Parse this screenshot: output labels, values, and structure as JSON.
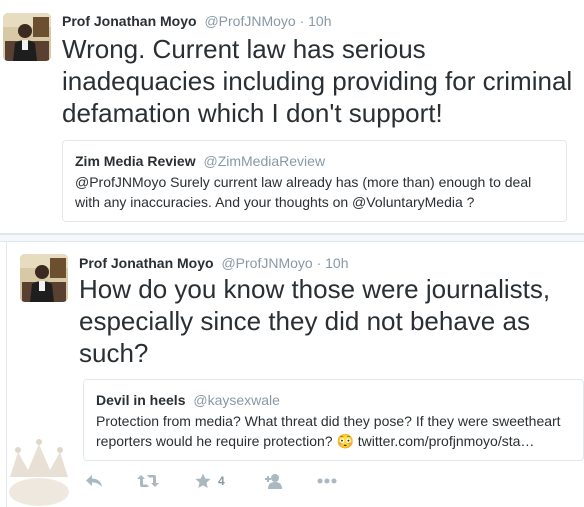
{
  "tweets": [
    {
      "author_name": "Prof Jonathan Moyo",
      "author_handle": "@ProfJNMoyo",
      "separator": "·",
      "time": "10h",
      "text": "Wrong. Current law has serious inadequacies including providing for criminal defamation which I don't support!",
      "quote": {
        "author_name": "Zim Media Review",
        "author_handle": "@ZimMediaReview",
        "text": "@ProfJNMoyo Surely current law already has (more than) enough to deal with any inaccuracies. And your thoughts on @VoluntaryMedia ?"
      }
    },
    {
      "author_name": "Prof Jonathan Moyo",
      "author_handle": "@ProfJNMoyo",
      "separator": "·",
      "time": "10h",
      "text": "How do you know those were journalists, especially since they did not behave as such?",
      "quote": {
        "author_name": "Devil in heels",
        "author_handle": "@kaysexwale",
        "text": "Protection from media? What threat did they pose? If they were sweetheart reporters would he require protection? 😳 twitter.com/profjnmoyo/sta…"
      },
      "actions": {
        "reply_icon": "reply-icon",
        "retweet_icon": "retweet-icon",
        "favorite_icon": "star-icon",
        "favorite_count": "4",
        "follow_icon": "add-user-icon",
        "more_icon": "more-dots-icon"
      }
    }
  ],
  "colors": {
    "text": "#292f33",
    "muted": "#8899a6",
    "border": "#e1e8ed",
    "action_icon": "#aab8c2"
  }
}
